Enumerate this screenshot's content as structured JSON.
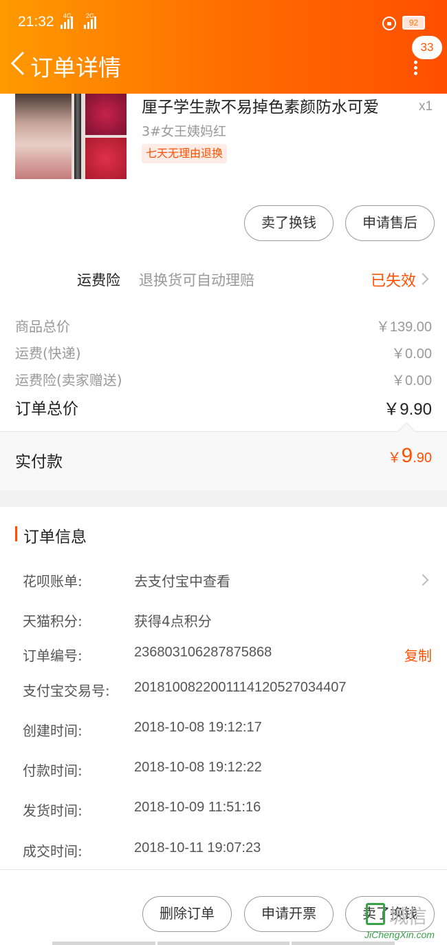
{
  "status_bar": {
    "time": "21:32",
    "signal1": "4G",
    "signal2": "2G",
    "battery": "92"
  },
  "header": {
    "title": "订单详情",
    "badge": "33"
  },
  "product": {
    "title": "厘子学生款不易掉色素颜防水可爱",
    "quantity": "x1",
    "sku": "3#女王姨妈红",
    "tag": "七天无理由退换"
  },
  "product_actions": {
    "sell": "卖了换钱",
    "after_sale": "申请售后"
  },
  "insurance": {
    "label": "运费险",
    "desc": "退换货可自动理赔",
    "status": "已失效"
  },
  "prices": {
    "goods_label": "商品总价",
    "goods_value": "￥139.00",
    "shipping_label": "运费(快递)",
    "shipping_value": "￥0.00",
    "ins_label": "运费险(卖家赠送)",
    "ins_value": "￥0.00",
    "total_label": "订单总价",
    "total_value": "￥9.90"
  },
  "paid": {
    "label": "实付款",
    "symbol": "￥",
    "integer": "9",
    "decimal": ".90"
  },
  "order_info": {
    "title": "订单信息",
    "huabei_label": "花呗账单:",
    "huabei_value": "去支付宝中查看",
    "points_label": "天猫积分:",
    "points_value": "获得4点积分",
    "order_no_label": "订单编号:",
    "order_no_value": "236803106287875868",
    "copy": "复制",
    "alipay_label": "支付宝交易号:",
    "alipay_value": "2018100822001114120527034407",
    "created_label": "创建时间:",
    "created_value": "2018-10-08 19:12:17",
    "paid_label": "付款时间:",
    "paid_value": "2018-10-08 19:12:22",
    "shipped_label": "发货时间:",
    "shipped_value": "2018-10-09 11:51:16",
    "closed_label": "成交时间:",
    "closed_value": "2018-10-11 19:07:23"
  },
  "bottom_actions": {
    "delete": "删除订单",
    "invoice": "申请开票",
    "sell": "卖了换钱"
  },
  "watermark": {
    "cn": "城信",
    "en": "JiChengXin.com"
  },
  "colors": {
    "accent": "#ff5000",
    "header_start": "#ff9a00",
    "header_end": "#ff5000"
  }
}
